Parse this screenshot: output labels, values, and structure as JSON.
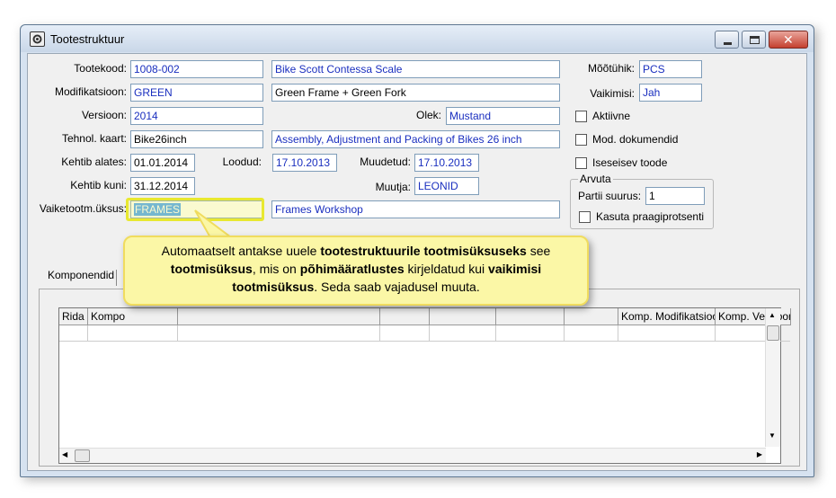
{
  "window": {
    "title": "Tootestruktuur",
    "buttons": {
      "minimize": "minimize-icon",
      "maximize": "maximize-icon",
      "close": "close-icon"
    }
  },
  "form": {
    "tootekood": {
      "label": "Tootekood:",
      "value": "1008-002",
      "description": "Bike Scott Contessa Scale"
    },
    "modifikatsioon": {
      "label": "Modifikatsioon:",
      "value": "GREEN",
      "description": "Green Frame + Green Fork"
    },
    "versioon": {
      "label": "Versioon:",
      "value": "2014"
    },
    "olek": {
      "label": "Olek:",
      "value": "Mustand"
    },
    "tehnol_kaart": {
      "label": "Tehnol. kaart:",
      "value": "Bike26inch",
      "description": "Assembly, Adjustment and Packing of Bikes 26 inch"
    },
    "kehtib_alates": {
      "label": "Kehtib alates:",
      "value": "01.01.2014"
    },
    "loodud": {
      "label": "Loodud:",
      "value": "17.10.2013"
    },
    "muudetud": {
      "label": "Muudetud:",
      "value": "17.10.2013"
    },
    "kehtib_kuni": {
      "label": "Kehtib kuni:",
      "value": "31.12.2014"
    },
    "muutja": {
      "label": "Muutja:",
      "value": "LEONID"
    },
    "vaiketootm": {
      "label": "Vaiketootm.üksus:",
      "value": "FRAMES",
      "description": "Frames Workshop"
    },
    "mootuhik": {
      "label": "Mõõtühik:",
      "value": "PCS"
    },
    "vaikimisi": {
      "label": "Vaikimisi:",
      "value": "Jah"
    },
    "aktiivne": {
      "label": "Aktiivne"
    },
    "mod_dokumendid": {
      "label": "Mod. dokumendid"
    },
    "iseseisev": {
      "label": "Iseseisev toode"
    },
    "arvuta": {
      "title": "Arvuta",
      "partii_label": "Partii suurus:",
      "partii_value": "1",
      "kasuta_label": "Kasuta praagiprotsenti"
    }
  },
  "tabs": {
    "komponendid": "Komponendid"
  },
  "grid": {
    "columns": [
      "Rida",
      "Kompo",
      "Komp. Modifikatsioo",
      "Komp. Versioon"
    ]
  },
  "tooltip": {
    "parts": [
      {
        "t": "Automaatselt antakse uuele ",
        "b": false
      },
      {
        "t": "tootestruktuurile tootmisüksuseks",
        "b": true
      },
      {
        "t": " see ",
        "b": false
      },
      {
        "t": "tootmisüksus",
        "b": true
      },
      {
        "t": ", mis on ",
        "b": false
      },
      {
        "t": "põhimääratlustes",
        "b": true
      },
      {
        "t": " kirjeldatud kui ",
        "b": false
      },
      {
        "t": "vaikimisi tootmisüksus",
        "b": true
      },
      {
        "t": ". Seda saab vajadusel muuta.",
        "b": false
      }
    ]
  }
}
